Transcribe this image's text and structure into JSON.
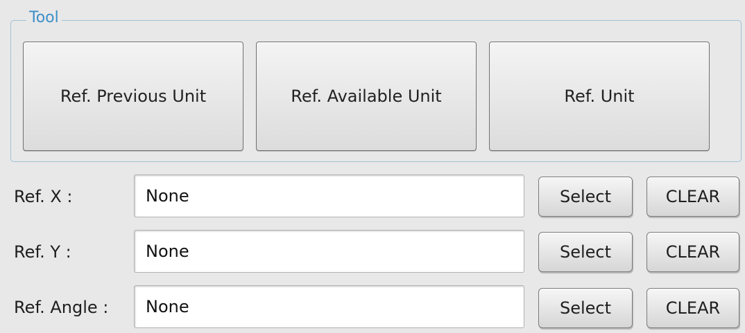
{
  "tool_group": {
    "title": "Tool",
    "buttons": {
      "ref_previous_unit": "Ref. Previous Unit",
      "ref_available_unit": "Ref. Available Unit",
      "ref_unit": "Ref. Unit"
    }
  },
  "rows": [
    {
      "label": "Ref. X :",
      "value": "None",
      "select_label": "Select",
      "clear_label": "CLEAR"
    },
    {
      "label": "Ref. Y :",
      "value": "None",
      "select_label": "Select",
      "clear_label": "CLEAR"
    },
    {
      "label": "Ref. Angle :",
      "value": "None",
      "select_label": "Select",
      "clear_label": "CLEAR"
    }
  ],
  "colors": {
    "background": "#e8e8e8",
    "group_title": "#3c8fc8",
    "group_border": "#9fc0d6"
  }
}
